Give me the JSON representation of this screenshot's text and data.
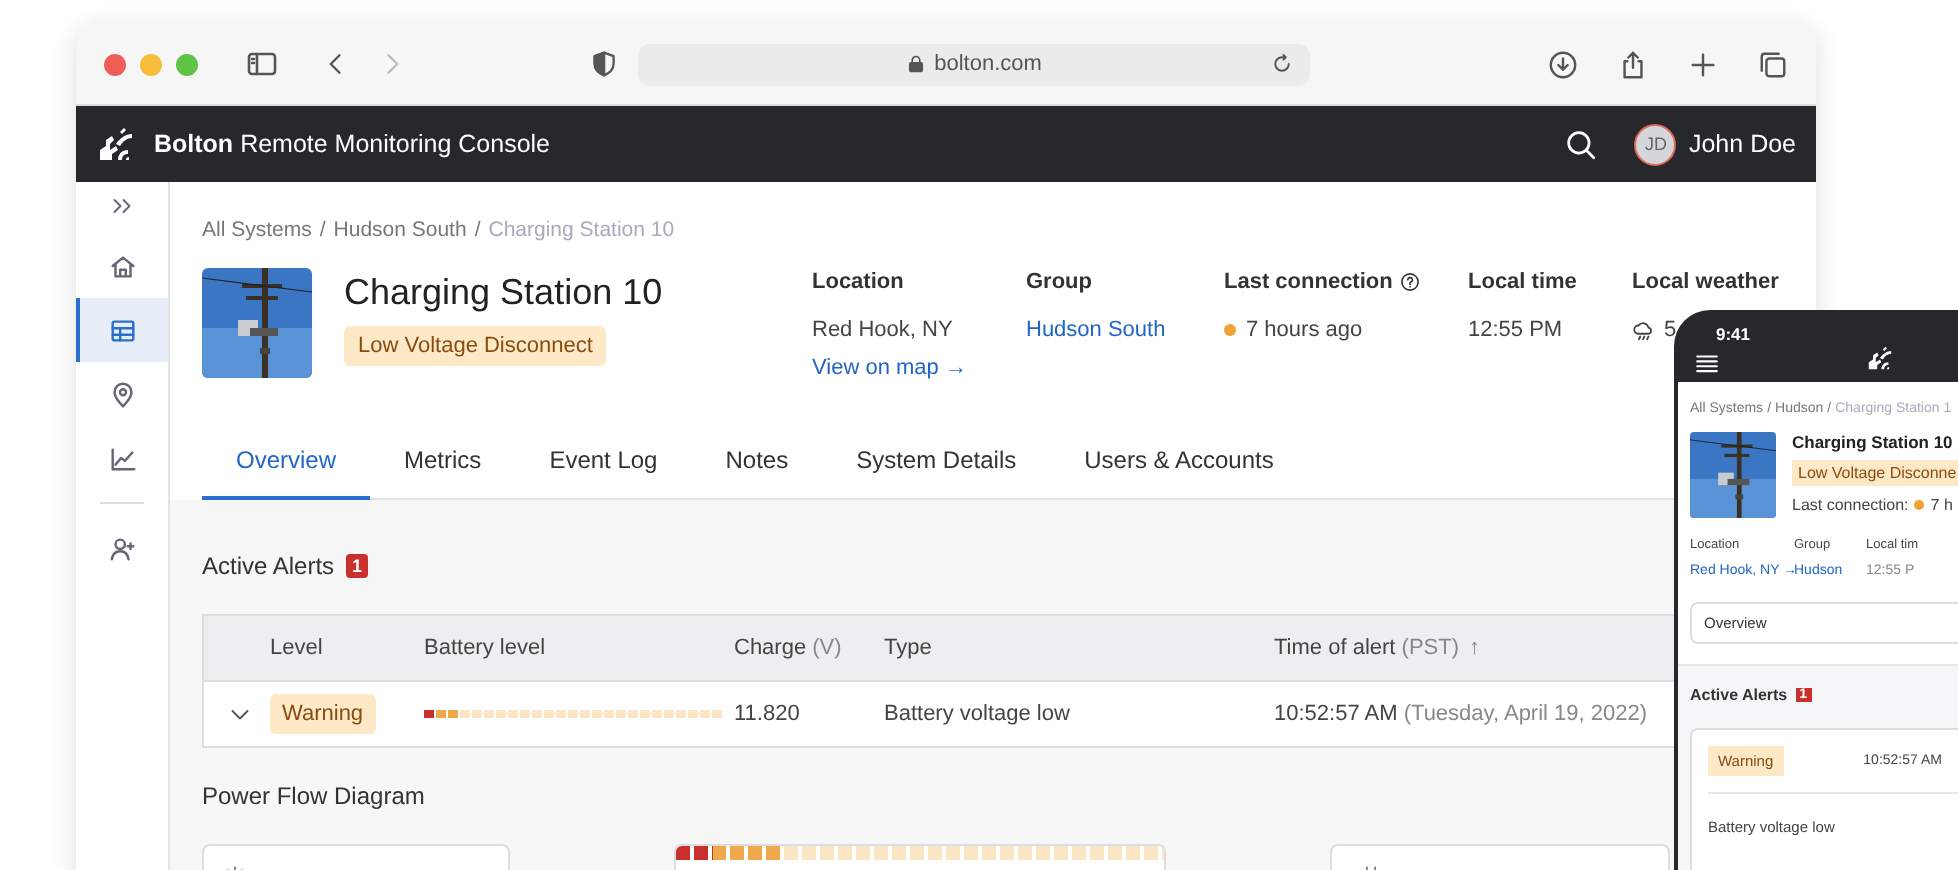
{
  "browser": {
    "url": "bolton.com"
  },
  "app": {
    "brand": "Bolton",
    "title": "Remote Monitoring Console",
    "user": {
      "initials": "JD",
      "name": "John Doe"
    }
  },
  "sidebar": {
    "items": [
      {
        "kind": "home",
        "selected": false
      },
      {
        "kind": "table",
        "selected": true
      },
      {
        "kind": "pin",
        "selected": false
      },
      {
        "kind": "chart",
        "selected": false
      },
      {
        "kind": "user",
        "selected": false
      }
    ]
  },
  "breadcrumb": {
    "separator": "/",
    "items": [
      "All Systems",
      "Hudson South",
      "Charging Station 10"
    ]
  },
  "station": {
    "name": "Charging Station 10",
    "status": "Low Voltage Disconnect"
  },
  "info": [
    {
      "kind": "text",
      "label": "Location",
      "value": "Red Hook, NY",
      "link": "View on map →"
    },
    {
      "kind": "link",
      "label": "Group",
      "value": "Hudson South"
    },
    {
      "kind": "status",
      "label": "Last connection",
      "help": true,
      "value": "7 hours ago",
      "color": "#f0a233"
    },
    {
      "kind": "text",
      "label": "Local time",
      "value": "12:55 PM"
    },
    {
      "kind": "weather",
      "label": "Local weather",
      "value": "5"
    }
  ],
  "tabs": [
    {
      "label": "Overview",
      "selected": true
    },
    {
      "label": "Metrics",
      "selected": false
    },
    {
      "label": "Event Log",
      "selected": false
    },
    {
      "label": "Notes",
      "selected": false
    },
    {
      "label": "System Details",
      "selected": false
    },
    {
      "label": "Users & Accounts",
      "selected": false
    }
  ],
  "alerts": {
    "title": "Active Alerts",
    "count": "1",
    "columns": [
      {
        "label": "Level"
      },
      {
        "label": "Battery level"
      },
      {
        "label": "Charge",
        "unit": "(V)"
      },
      {
        "label": "Type"
      },
      {
        "label": "Time of alert",
        "unit": "(PST)",
        "sort": "↑"
      }
    ],
    "rows": [
      {
        "expanded": false,
        "severity": "Warning",
        "battery": {
          "level": 0.12
        },
        "charge": "11.820",
        "type": "Battery voltage low",
        "time": "10:52:57 AM",
        "date": "(Tuesday, April 19, 2022)"
      }
    ]
  },
  "power_flow": {
    "title": "Power Flow Diagram",
    "battery": {
      "level": 0.2
    }
  },
  "phone": {
    "time": "9:41",
    "breadcrumb": {
      "items": [
        "All Systems",
        "Hudson"
      ],
      "current": "Charging Station 1"
    },
    "name": "Charging Station 10",
    "status": "Low Voltage Disconne",
    "connection_label": "Last connection:",
    "connection": {
      "text": "7 h",
      "color": "#f0a233"
    },
    "info": [
      {
        "label": "Location",
        "value": "Red Hook, NY →",
        "kind": "link"
      },
      {
        "label": "Group",
        "value": "Hudson",
        "kind": "link"
      },
      {
        "label": "Local tim",
        "value": "12:55 P",
        "kind": "text"
      }
    ],
    "view": "Overview",
    "alerts_title": "Active Alerts",
    "alerts_count": "1",
    "alert": {
      "severity": "Warning",
      "time": "10:52:57 AM",
      "type": "Battery voltage low"
    }
  }
}
